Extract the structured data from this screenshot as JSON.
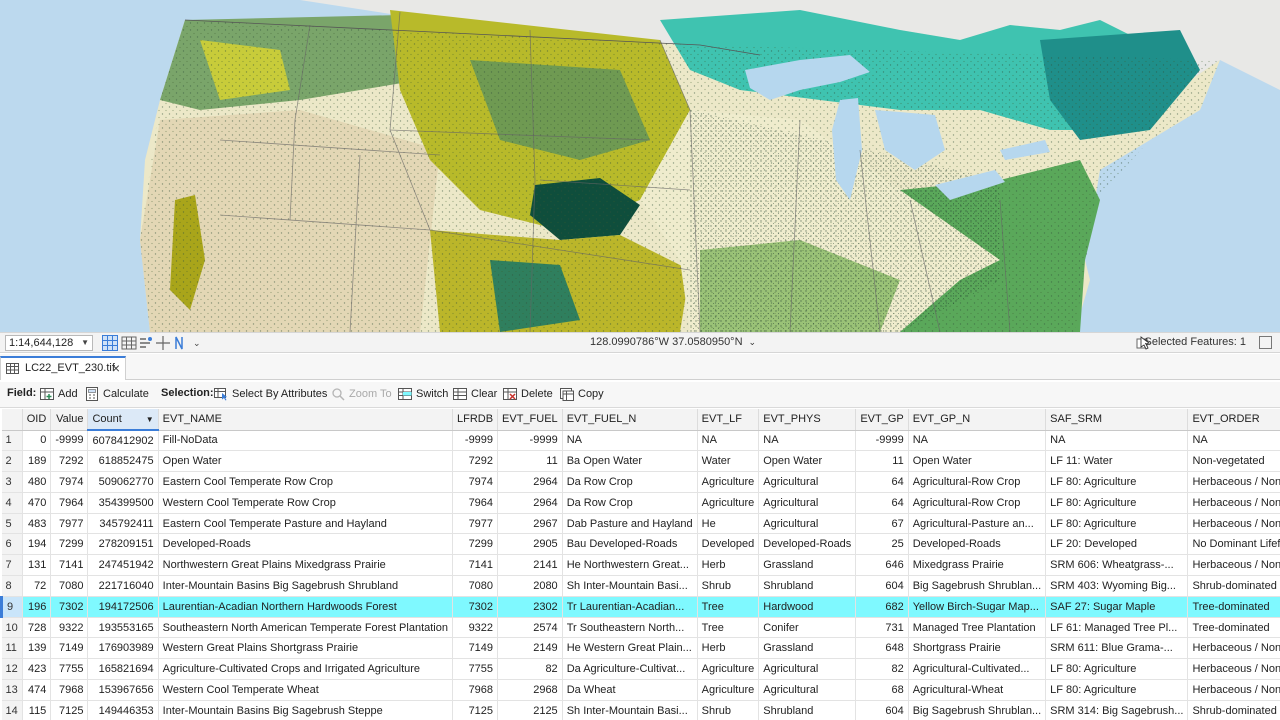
{
  "map": {
    "scale": "1:14,644,128",
    "coordinates": "128.0990786°W 37.0580950°N",
    "selected_features": "Selected Features: 1"
  },
  "tab": {
    "label": "LC22_EVT_230.tif"
  },
  "toolbar": {
    "field_label": "Field:",
    "add": "Add",
    "calculate": "Calculate",
    "selection_label": "Selection:",
    "select_by_attributes": "Select By Attributes",
    "zoom_to": "Zoom To",
    "switch": "Switch",
    "clear": "Clear",
    "delete": "Delete",
    "copy": "Copy"
  },
  "table": {
    "columns": [
      "OID",
      "Value",
      "Count",
      "EVT_NAME",
      "LFRDB",
      "EVT_FUEL",
      "EVT_FUEL_N",
      "EVT_LF",
      "EVT_PHYS",
      "EVT_GP",
      "EVT_GP_N",
      "SAF_SRM",
      "EVT_ORDER"
    ],
    "sorted_column": "Count",
    "selected_row": 9,
    "rows": [
      [
        "1",
        "0",
        "-9999",
        "6078412902",
        "Fill-NoData",
        "-9999",
        "-9999",
        "NA",
        "NA",
        "NA",
        "-9999",
        "NA",
        "NA",
        "NA"
      ],
      [
        "2",
        "189",
        "7292",
        "618852475",
        "Open Water",
        "7292",
        "11",
        "Ba Open Water",
        "Water",
        "Open Water",
        "11",
        "Open Water",
        "LF 11: Water",
        "Non-vegetated"
      ],
      [
        "3",
        "480",
        "7974",
        "509062770",
        "Eastern Cool Temperate Row Crop",
        "7974",
        "2964",
        "Da Row Crop",
        "Agriculture",
        "Agricultural",
        "64",
        "Agricultural-Row Crop",
        "LF 80: Agriculture",
        "Herbaceous / Nonvascu..."
      ],
      [
        "4",
        "470",
        "7964",
        "354399500",
        "Western Cool Temperate Row Crop",
        "7964",
        "2964",
        "Da Row Crop",
        "Agriculture",
        "Agricultural",
        "64",
        "Agricultural-Row Crop",
        "LF 80: Agriculture",
        "Herbaceous / Nonvascu..."
      ],
      [
        "5",
        "483",
        "7977",
        "345792411",
        "Eastern Cool Temperate Pasture and Hayland",
        "7977",
        "2967",
        "Dab Pasture and Hayland",
        "He",
        "Agricultural",
        "67",
        "Agricultural-Pasture an...",
        "LF 80: Agriculture",
        "Herbaceous / Nonvascu..."
      ],
      [
        "6",
        "194",
        "7299",
        "278209151",
        "Developed-Roads",
        "7299",
        "2905",
        "Bau Developed-Roads",
        "Developed",
        "Developed-Roads",
        "25",
        "Developed-Roads",
        "LF 20: Developed",
        "No Dominant Lifeform"
      ],
      [
        "7",
        "131",
        "7141",
        "247451942",
        "Northwestern Great Plains Mixedgrass Prairie",
        "7141",
        "2141",
        "He Northwestern Great...",
        "Herb",
        "Grassland",
        "646",
        "Mixedgrass Prairie",
        "SRM 606: Wheatgrass-...",
        "Herbaceous / Nonvascu..."
      ],
      [
        "8",
        "72",
        "7080",
        "221716040",
        "Inter-Mountain Basins Big Sagebrush Shrubland",
        "7080",
        "2080",
        "Sh Inter-Mountain Basi...",
        "Shrub",
        "Shrubland",
        "604",
        "Big Sagebrush Shrublan...",
        "SRM 403: Wyoming Big...",
        "Shrub-dominated"
      ],
      [
        "9",
        "196",
        "7302",
        "194172506",
        "Laurentian-Acadian Northern Hardwoods Forest",
        "7302",
        "2302",
        "Tr Laurentian-Acadian...",
        "Tree",
        "Hardwood",
        "682",
        "Yellow Birch-Sugar Map...",
        "SAF 27: Sugar Maple",
        "Tree-dominated"
      ],
      [
        "10",
        "728",
        "9322",
        "193553165",
        "Southeastern North American Temperate Forest Plantation",
        "9322",
        "2574",
        "Tr Southeastern North...",
        "Tree",
        "Conifer",
        "731",
        "Managed Tree Plantation",
        "LF 61: Managed Tree Pl...",
        "Tree-dominated"
      ],
      [
        "11",
        "139",
        "7149",
        "176903989",
        "Western Great Plains Shortgrass Prairie",
        "7149",
        "2149",
        "He Western Great Plain...",
        "Herb",
        "Grassland",
        "648",
        "Shortgrass Prairie",
        "SRM 611: Blue Grama-...",
        "Herbaceous / Nonvascu..."
      ],
      [
        "12",
        "423",
        "7755",
        "165821694",
        "Agriculture-Cultivated Crops and Irrigated Agriculture",
        "7755",
        "82",
        "Da Agriculture-Cultivat...",
        "Agriculture",
        "Agricultural",
        "82",
        "Agricultural-Cultivated...",
        "LF 80: Agriculture",
        "Herbaceous / Nonvascu..."
      ],
      [
        "13",
        "474",
        "7968",
        "153967656",
        "Western Cool Temperate Wheat",
        "7968",
        "2968",
        "Da Wheat",
        "Agriculture",
        "Agricultural",
        "68",
        "Agricultural-Wheat",
        "LF 80: Agriculture",
        "Herbaceous / Nonvascu..."
      ],
      [
        "14",
        "115",
        "7125",
        "149446353",
        "Inter-Mountain Basins Big Sagebrush Steppe",
        "7125",
        "2125",
        "Sh Inter-Mountain Basi...",
        "Shrub",
        "Shrubland",
        "604",
        "Big Sagebrush Shrublan...",
        "SRM 314: Big Sagebrush...",
        "Shrub-dominated"
      ]
    ]
  }
}
